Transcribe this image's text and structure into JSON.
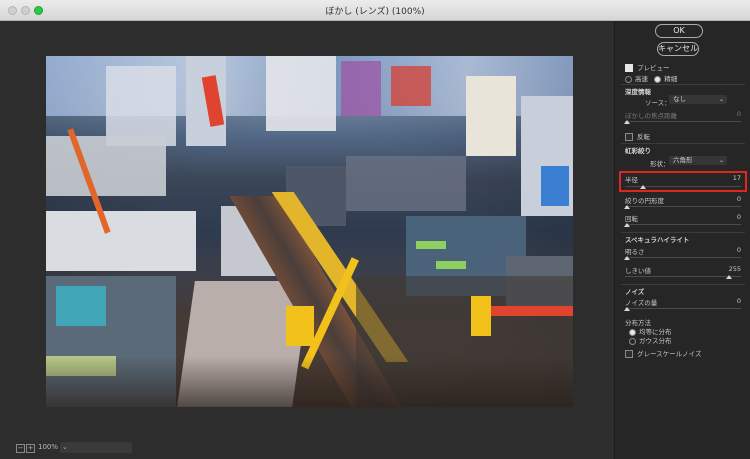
{
  "window": {
    "title": "ぼかし (レンズ) (100%)"
  },
  "status": {
    "zoom": "100%",
    "zoom_out": "−",
    "zoom_in": "+"
  },
  "panel": {
    "ok": "OK",
    "cancel": "キャンセル",
    "preview": "プレビュー",
    "quality_fast": "高速",
    "quality_accurate": "精細",
    "depth": {
      "heading": "深度情報",
      "source_label": "ソース：",
      "source_value": "なし",
      "focal_label": "ぼかしの焦点距離",
      "focal_value": "0",
      "invert": "反転"
    },
    "iris": {
      "heading": "虹彩絞り",
      "shape_label": "形状：",
      "shape_value": "六角形",
      "radius_label": "半径",
      "radius_value": "17",
      "curvature_label": "絞りの円形度",
      "curvature_value": "0",
      "rotation_label": "回転",
      "rotation_value": "0"
    },
    "specular": {
      "heading": "スペキュラハイライト",
      "brightness_label": "明るさ",
      "brightness_value": "0",
      "threshold_label": "しきい値",
      "threshold_value": "255"
    },
    "noise": {
      "heading": "ノイズ",
      "amount_label": "ノイズの量",
      "amount_value": "0",
      "distribution_label": "分布方法",
      "uniform": "均等に分布",
      "gaussian": "ガウス分布",
      "monochrome": "グレースケールノイズ"
    }
  },
  "colors": {
    "highlight": "#e0261e",
    "crane": "#f2c21a",
    "crane_red": "#e0442e"
  }
}
